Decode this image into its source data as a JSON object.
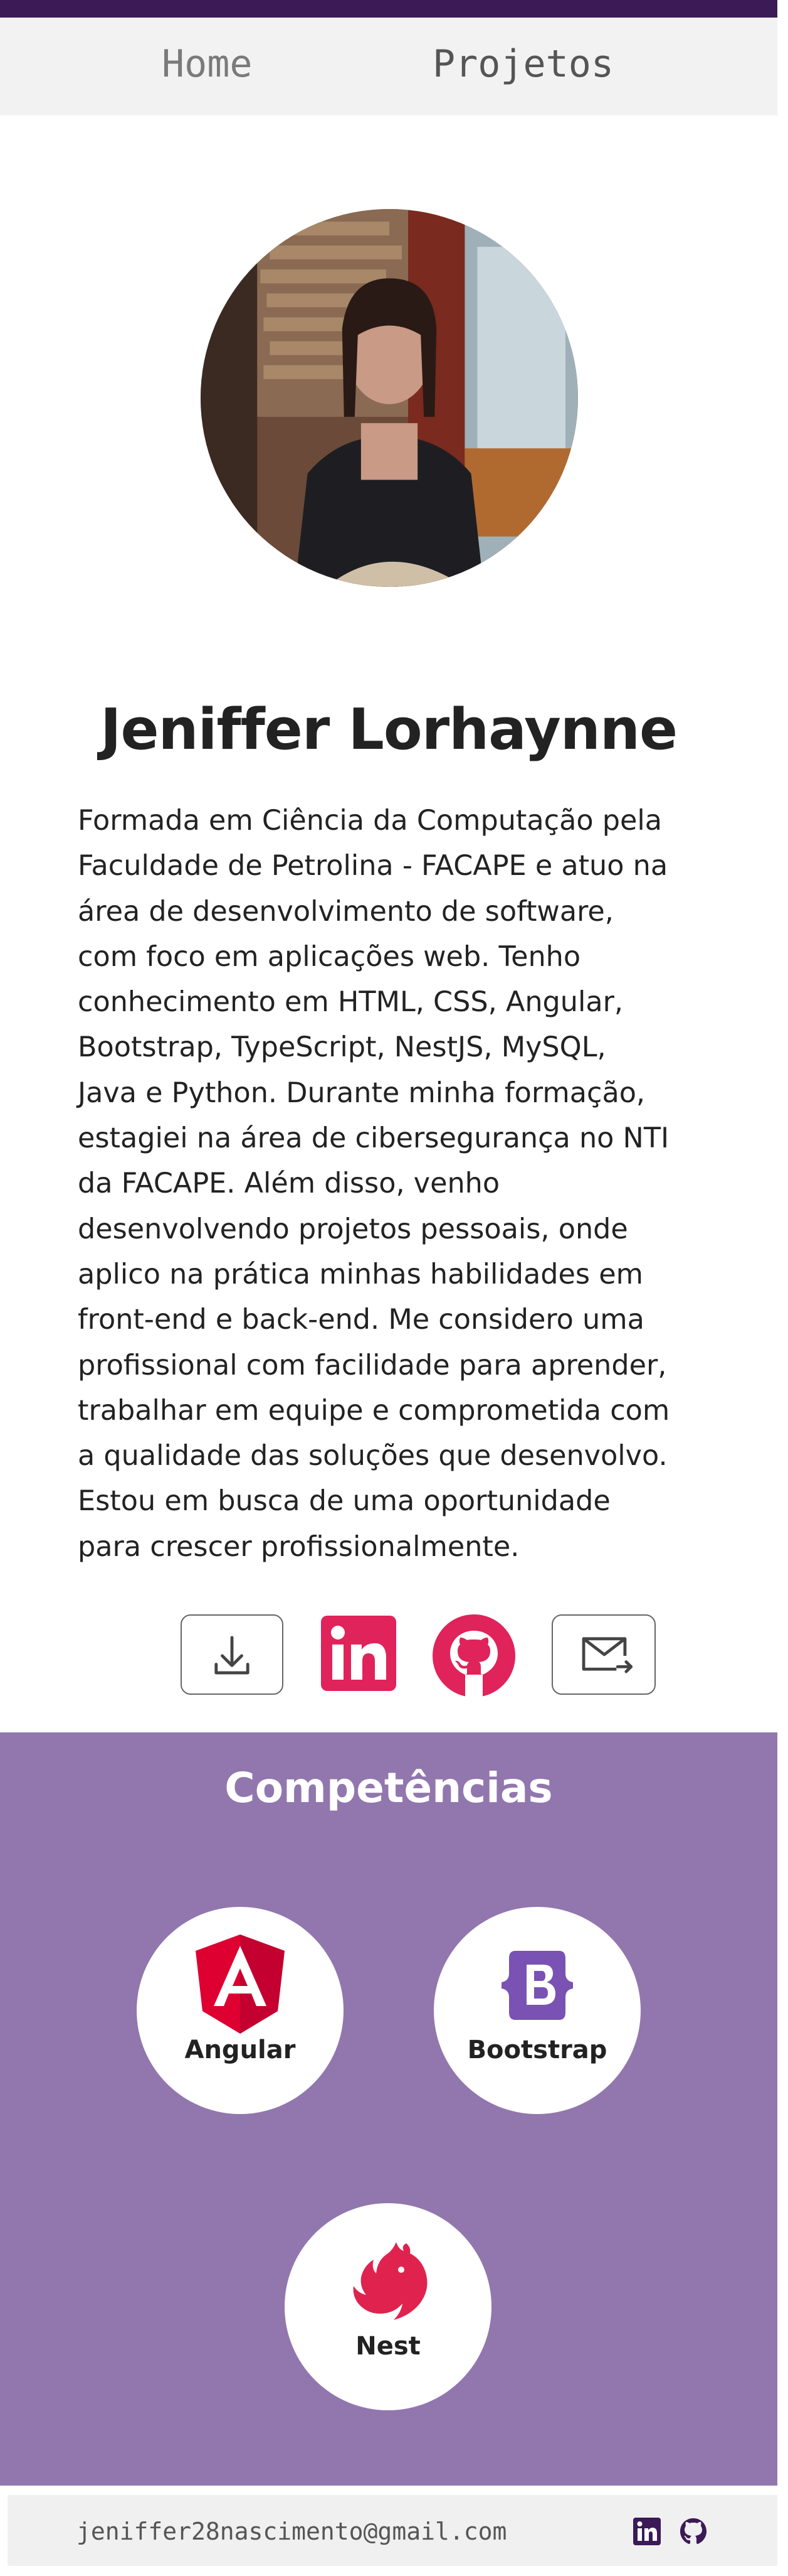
{
  "nav": {
    "home_label": "Home",
    "projetos_label": "Projetos"
  },
  "profile": {
    "name": "Jeniffer Lorhaynne",
    "bio_lines": [
      "Formada em Ciência da Computação pela",
      "Faculdade de Petrolina - FACAPE e atuo na",
      "área de desenvolvimento de software,",
      "com foco em aplicações web. Tenho",
      "conhecimento em HTML, CSS, Angular,",
      "Bootstrap, TypeScript, NestJS, MySQL,",
      "Java e Python. Durante minha formação,",
      "estagiei na área de cibersegurança no NTI",
      "da FACAPE. Além disso, venho",
      "desenvolvendo projetos pessoais, onde",
      "aplico na prática minhas habilidades em",
      "front-end e back-end. Me considero uma",
      "profissional com facilidade para aprender,",
      "trabalhar em equipe e comprometida com",
      "a qualidade das soluções que desenvolvo.",
      "Estou em busca de uma oportunidade",
      "para crescer profissionalmente."
    ]
  },
  "actions": {
    "download_icon": "download-icon",
    "linkedin_icon": "linkedin-icon",
    "github_icon": "github-icon",
    "email_icon": "email-icon"
  },
  "skills": {
    "title": "Competências",
    "items": [
      {
        "label": "Angular",
        "icon": "angular-icon"
      },
      {
        "label": "Bootstrap",
        "icon": "bootstrap-icon"
      },
      {
        "label": "Nest",
        "icon": "nest-icon"
      }
    ]
  },
  "footer": {
    "email": "jeniffer28nascimento@gmail.com"
  },
  "colors": {
    "topbar": "#3b1a55",
    "accent": "#e0235a",
    "skills_bg": "#9177ae"
  }
}
